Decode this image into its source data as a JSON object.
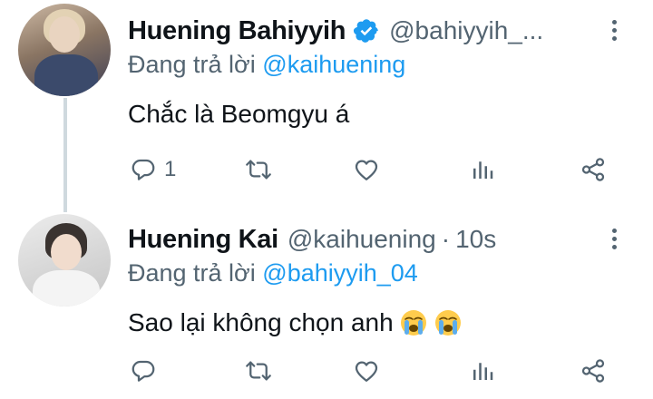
{
  "tweets": [
    {
      "name": "Huening Bahiyyih",
      "handle": "@bahiyyih_...",
      "verified": true,
      "replying_prefix": "Đang trả lời",
      "replying_to": "@kaihuening",
      "text": "Chắc là Beomgyu á",
      "reply_count": "1",
      "actions": [
        "reply-icon",
        "retweet-icon",
        "like-icon",
        "views-icon",
        "share-icon"
      ]
    },
    {
      "name": "Huening Kai",
      "handle": "@kaihuening",
      "separator": "·",
      "time": "10s",
      "replying_prefix": "Đang trả lời",
      "replying_to": "@bahiyyih_04",
      "text": "Sao lại không chọn anh",
      "emojis": [
        "loudly-crying-face",
        "loudly-crying-face"
      ],
      "actions": [
        "reply-icon",
        "retweet-icon",
        "like-icon",
        "views-icon",
        "share-icon"
      ]
    }
  ],
  "colors": {
    "accent": "#1d9bf0",
    "secondary_text": "#536471",
    "thread_line": "#cfd9de"
  }
}
